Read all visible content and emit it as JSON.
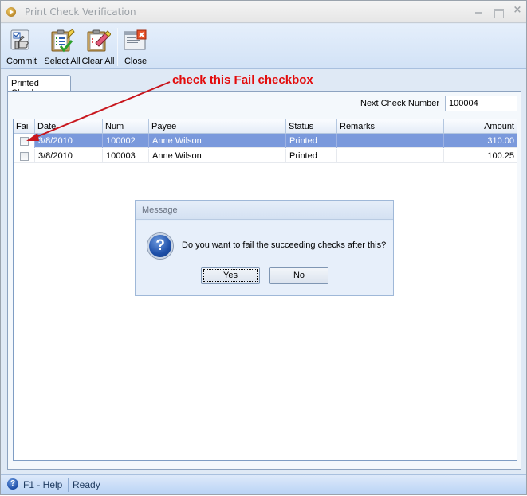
{
  "window": {
    "title": "Print Check Verification",
    "controls": {
      "minimize": "minimize",
      "maximize": "maximize",
      "close": "×"
    }
  },
  "toolbar": {
    "buttons": [
      {
        "label": "Commit",
        "icon": "commit-thumbs-up-icon"
      },
      {
        "label": "Select All",
        "icon": "select-all-clipboard-icon"
      },
      {
        "label": "Clear All",
        "icon": "clear-all-eraser-icon"
      },
      {
        "label": "Close",
        "icon": "close-window-icon"
      }
    ]
  },
  "tabs": [
    {
      "label": "Printed Checks",
      "active": true
    }
  ],
  "next_check": {
    "label": "Next Check Number",
    "value": "100004"
  },
  "grid": {
    "columns": [
      "Fail",
      "Date",
      "Num",
      "Payee",
      "Status",
      "Remarks",
      "Amount"
    ],
    "rows": [
      {
        "fail": false,
        "date": "3/8/2010",
        "num": "100002",
        "payee": "Anne Wilson",
        "status": "Printed",
        "remarks": "",
        "amount": "310.00",
        "selected": true
      },
      {
        "fail": false,
        "date": "3/8/2010",
        "num": "100003",
        "payee": "Anne Wilson",
        "status": "Printed",
        "remarks": "",
        "amount": "100.25",
        "selected": false
      }
    ]
  },
  "annotation": {
    "text": "check this Fail checkbox",
    "color": "#e30b0b"
  },
  "dialog": {
    "title": "Message",
    "message": "Do you want to fail the succeeding checks after this?",
    "icon": "?",
    "yes_label": "Yes",
    "no_label": "No"
  },
  "statusbar": {
    "help": "F1 - Help",
    "help_icon": "?",
    "status": "Ready"
  },
  "colors": {
    "selected_row": "#7a99dc",
    "annotation": "#e30b0b"
  }
}
